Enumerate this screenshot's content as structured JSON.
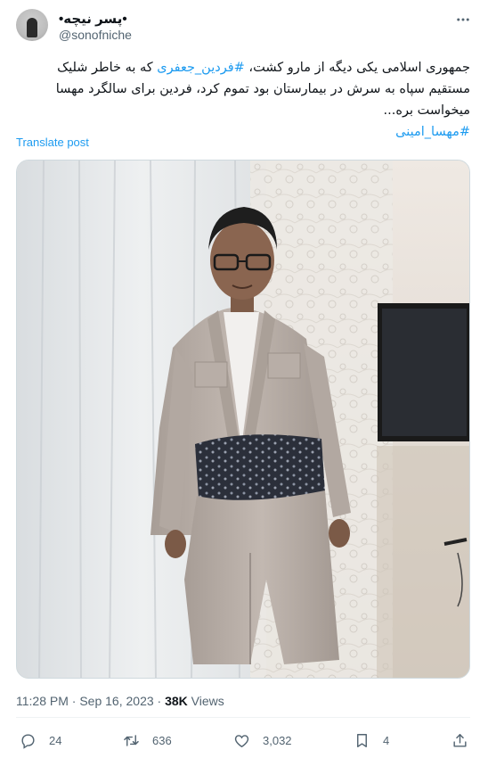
{
  "author": {
    "name": "•پسر نیچه•",
    "handle": "@sonofniche"
  },
  "post": {
    "text_part1": "جمهوری اسلامی یکی دیگه از مارو کشت، ",
    "hashtag1": "#فردین_جعفری",
    "text_part2": " که به خاطر شلیک مستقیم سپاه به سرش در بیمارستان بود تموم کرد، فردین برای سالگرد مهسا میخواست بره...",
    "hashtag2": "#مهسا_امینی",
    "translate_label": "Translate post"
  },
  "meta": {
    "time": "11:28 PM",
    "separator": "·",
    "date": "Sep 16, 2023",
    "views_count": "38K",
    "views_label": "Views"
  },
  "actions": {
    "replies": "24",
    "reposts": "636",
    "likes": "3,032",
    "bookmarks": "4"
  },
  "icons": [
    "more-icon",
    "reply-icon",
    "retweet-icon",
    "like-icon",
    "bookmark-icon",
    "share-icon"
  ],
  "colors": {
    "link": "#1d9bf0",
    "secondary_text": "#536471",
    "primary_text": "#0f1419"
  }
}
